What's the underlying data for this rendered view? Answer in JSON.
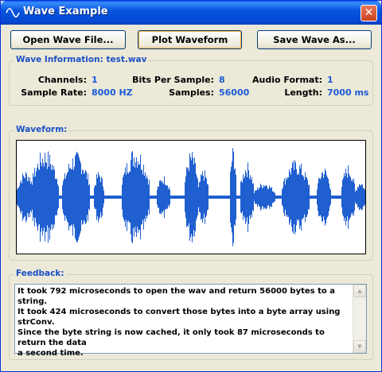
{
  "window": {
    "title": "Wave Example",
    "close_glyph": "✕"
  },
  "toolbar": {
    "open_label": "Open Wave File...",
    "plot_label": "Plot Waveform",
    "save_label": "Save Wave As..."
  },
  "info": {
    "title": "Wave Information: test.wav",
    "channels": {
      "label": "Channels:",
      "value": "1"
    },
    "bits": {
      "label": "Bits Per Sample:",
      "value": "8"
    },
    "format": {
      "label": "Audio Format:",
      "value": "1"
    },
    "rate": {
      "label": "Sample Rate:",
      "value": "8000 HZ"
    },
    "samples": {
      "label": "Samples:",
      "value": "56000"
    },
    "length": {
      "label": "Length:",
      "value": "7000 ms"
    }
  },
  "waveform": {
    "title": "Waveform:",
    "color": "#1f5fcf"
  },
  "feedback": {
    "title": "Feedback:",
    "text": "It took 792 microseconds to open the wav and return 56000 bytes to a string.\nIt took 424 microseconds to convert those bytes into a byte array using strConv.\nSince the byte string is now cached, it only took 87 microseconds to return the data\na second time."
  }
}
